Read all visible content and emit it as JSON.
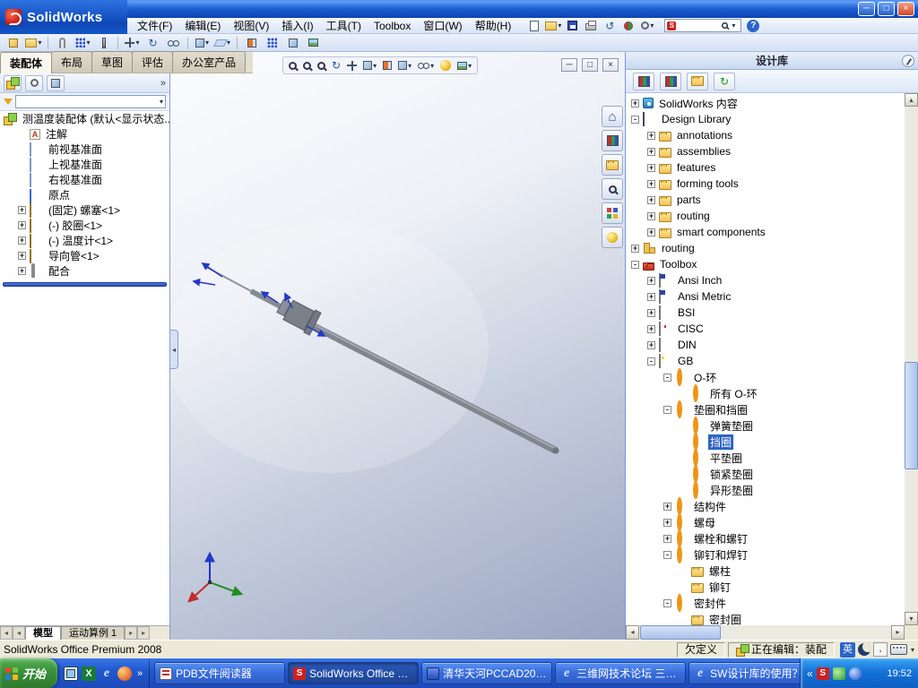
{
  "titlebar": {
    "title": "SolidWorks"
  },
  "menubar": {
    "items": [
      "文件(F)",
      "编辑(E)",
      "视图(V)",
      "插入(I)",
      "工具(T)",
      "Toolbox",
      "窗口(W)",
      "帮助(H)"
    ],
    "search_value": ""
  },
  "command_tabs": [
    "装配体",
    "布局",
    "草图",
    "评估",
    "办公室产品"
  ],
  "feature_panel": {
    "root_label": "测温度装配体 (默认<显示状态...",
    "items": [
      "注解",
      "前视基准面",
      "上视基准面",
      "右视基准面",
      "原点",
      "(固定) 螺塞<1>",
      "(-) 胶圈<1>",
      "(-) 温度计<1>",
      "导向管<1>",
      "配合"
    ],
    "bottom_tabs": [
      "模型",
      "运动算例 1"
    ]
  },
  "task_pane": {
    "title": "设计库",
    "selected": "挡圈",
    "tree": [
      {
        "label": "SolidWorks 内容"
      },
      {
        "label": "Design Library"
      },
      {
        "label": "annotations"
      },
      {
        "label": "assemblies"
      },
      {
        "label": "features"
      },
      {
        "label": "forming tools"
      },
      {
        "label": "parts"
      },
      {
        "label": "routing"
      },
      {
        "label": "smart components"
      },
      {
        "label": "routing"
      },
      {
        "label": "Toolbox"
      },
      {
        "label": "Ansi Inch"
      },
      {
        "label": "Ansi Metric"
      },
      {
        "label": "BSI"
      },
      {
        "label": "CISC"
      },
      {
        "label": "DIN"
      },
      {
        "label": "GB"
      },
      {
        "label": "O-环"
      },
      {
        "label": "所有 O-环"
      },
      {
        "label": "垫圈和挡圈"
      },
      {
        "label": "弹簧垫圈"
      },
      {
        "label": "挡圈"
      },
      {
        "label": "平垫圈"
      },
      {
        "label": "锁紧垫圈"
      },
      {
        "label": "异形垫圈"
      },
      {
        "label": "结构件"
      },
      {
        "label": "螺母"
      },
      {
        "label": "螺栓和螺钉"
      },
      {
        "label": "铆钉和焊钉"
      },
      {
        "label": "螺柱"
      },
      {
        "label": "铆钉"
      },
      {
        "label": "密封件"
      },
      {
        "label": "密封圈"
      }
    ]
  },
  "statusbar": {
    "product": "SolidWorks Office Premium 2008",
    "define_state": "欠定义",
    "editing": "正在编辑：装配",
    "ime_lang": "英"
  },
  "taskbar": {
    "start_label": "开始",
    "tasks": [
      {
        "label": "PDB文件阅读器"
      },
      {
        "label": "SolidWorks Office Prem..."
      },
      {
        "label": "清华天河PCCAD2005..."
      },
      {
        "label": "三维网技术论坛 三维..."
      },
      {
        "label": "SW设计库的使用？..."
      }
    ],
    "clock": "19:52"
  },
  "glyphs": {
    "expand": "+",
    "collapse": "-",
    "dropdown": "▾",
    "overflow": "»",
    "tray_collapse": "«",
    "minimize": "─",
    "maximize": "□",
    "close": "×",
    "help": "?",
    "rotate": "↻",
    "undo": "↺",
    "home": "⌂",
    "scroll_up": "▴",
    "scroll_down": "▾",
    "scroll_left": "◂",
    "scroll_right": "▸"
  }
}
